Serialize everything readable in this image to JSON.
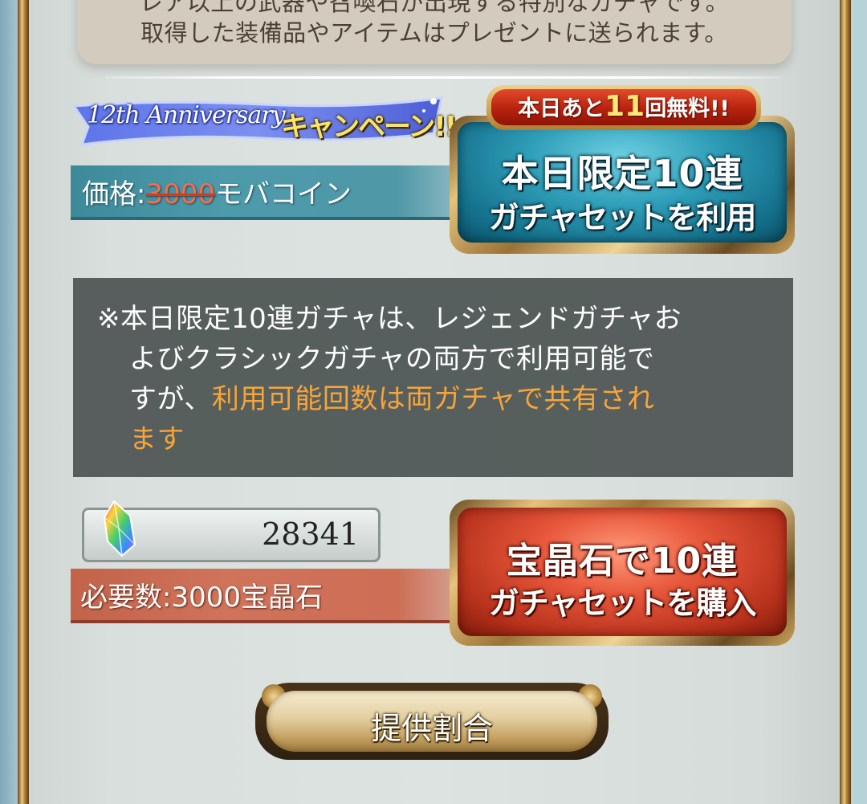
{
  "description": {
    "line1": "レア以上の武器や召喚石が出現する特別なガチャです。",
    "line2": "取得した装備品やアイテムはプレゼントに送られます。"
  },
  "campaign": {
    "anniversary_label": "12th Anniversary",
    "campaign_label": "キャンペーン!!",
    "price_prefix": "価格:",
    "price_original": "3000",
    "price_unit": "モバコイン"
  },
  "daily_button": {
    "badge_prefix": "本日あと",
    "badge_count": "11",
    "badge_suffix": "回無料!!",
    "line1": "本日限定10連",
    "line2": "ガチャセットを利用"
  },
  "notice": {
    "line1": "※本日限定10連ガチャは、レジェンドガチャお",
    "line2": "よびクラシックガチャの両方で利用可能で",
    "line3_normal": "すが、",
    "line3_highlight": "利用可能回数は両ガチャで共有され",
    "line4_highlight": "ます"
  },
  "gem_balance": {
    "count": "28341",
    "requirement": "必要数:3000宝晶石"
  },
  "purchase_button": {
    "line1": "宝晶石で10連",
    "line2": "ガチャセットを購入"
  },
  "rates_button": {
    "label": "提供割合"
  },
  "colors": {
    "highlight": "#f6a53a",
    "price_bar": "#4d9aab",
    "requirement_bar": "#cf735a"
  }
}
